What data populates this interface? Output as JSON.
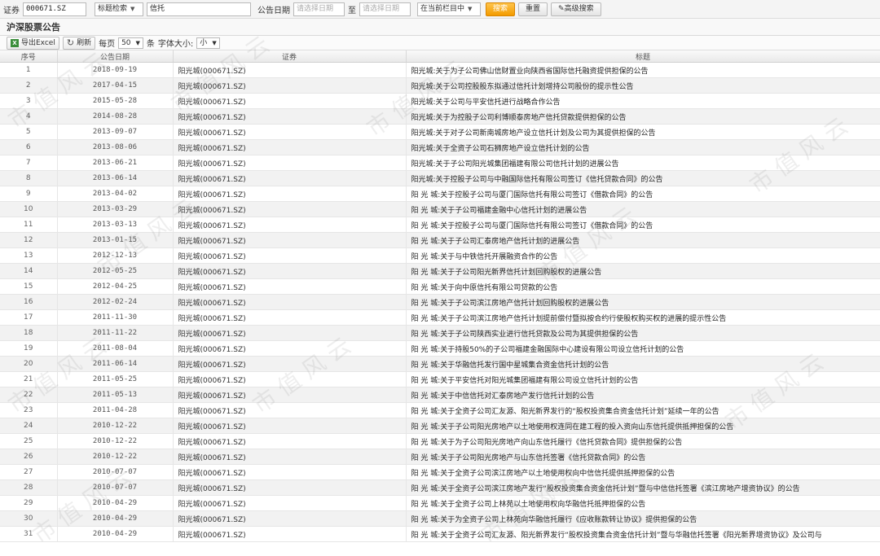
{
  "search": {
    "security_label": "证券",
    "security_value": "000671.SZ",
    "search_type": "标题检索",
    "keyword": "信托",
    "date_label": "公告日期",
    "date_from_placeholder": "请选择日期",
    "to_label": "至",
    "date_to_placeholder": "请选择日期",
    "scope": "在当前栏目中",
    "search_button": "搜索",
    "reset_button": "重置",
    "advanced_button": "高级搜索"
  },
  "section_title": "沪深股票公告",
  "toolbar": {
    "export_label": "导出Excel",
    "refresh_label": "刷新",
    "per_page_label": "每页",
    "per_page_value": "50",
    "per_page_unit": "条",
    "font_size_label": "字体大小:",
    "font_size_value": "小"
  },
  "table": {
    "headers": [
      "序号",
      "公告日期",
      "证券",
      "标题"
    ],
    "rows": [
      {
        "idx": "1",
        "date": "2018-09-19",
        "sec": "阳光城(000671.SZ)",
        "title": "阳光城:关于为子公司佛山信财置业向陕西省国际信托融资提供担保的公告"
      },
      {
        "idx": "2",
        "date": "2017-04-15",
        "sec": "阳光城(000671.SZ)",
        "title": "阳光城:关于公司控股股东拟通过信托计划增持公司股份的提示性公告"
      },
      {
        "idx": "3",
        "date": "2015-05-28",
        "sec": "阳光城(000671.SZ)",
        "title": "阳光城:关于公司与平安信托进行战略合作公告"
      },
      {
        "idx": "4",
        "date": "2014-08-28",
        "sec": "阳光城(000671.SZ)",
        "title": "阳光城:关于为控股子公司利博顺泰房地产信托贷款提供担保的公告"
      },
      {
        "idx": "5",
        "date": "2013-09-07",
        "sec": "阳光城(000671.SZ)",
        "title": "阳光城:关于对子公司新南城房地产设立信托计划及公司为其提供担保的公告"
      },
      {
        "idx": "6",
        "date": "2013-08-06",
        "sec": "阳光城(000671.SZ)",
        "title": "阳光城:关于全资子公司石狮房地产设立信托计划的公告"
      },
      {
        "idx": "7",
        "date": "2013-06-21",
        "sec": "阳光城(000671.SZ)",
        "title": "阳光城:关于子公司阳光城集团福建有限公司信托计划的进展公告"
      },
      {
        "idx": "8",
        "date": "2013-06-14",
        "sec": "阳光城(000671.SZ)",
        "title": "阳光城:关于控股子公司与中融国际信托有限公司签订《信托贷款合同》的公告"
      },
      {
        "idx": "9",
        "date": "2013-04-02",
        "sec": "阳光城(000671.SZ)",
        "title": "阳 光 城:关于控股子公司与厦门国际信托有限公司签订《借款合同》的公告"
      },
      {
        "idx": "10",
        "date": "2013-03-29",
        "sec": "阳光城(000671.SZ)",
        "title": "阳 光 城:关于子公司福建金融中心信托计划的进展公告"
      },
      {
        "idx": "11",
        "date": "2013-03-13",
        "sec": "阳光城(000671.SZ)",
        "title": "阳 光 城:关于控股子公司与厦门国际信托有限公司签订《借款合同》的公告"
      },
      {
        "idx": "12",
        "date": "2013-01-15",
        "sec": "阳光城(000671.SZ)",
        "title": "阳 光 城:关于子公司汇泰房地产信托计划的进展公告"
      },
      {
        "idx": "13",
        "date": "2012-12-13",
        "sec": "阳光城(000671.SZ)",
        "title": "阳 光 城:关于与中铁信托开展融资合作的公告"
      },
      {
        "idx": "14",
        "date": "2012-05-25",
        "sec": "阳光城(000671.SZ)",
        "title": "阳 光 城:关于子公司阳光新界信托计划回购股权的进展公告"
      },
      {
        "idx": "15",
        "date": "2012-04-25",
        "sec": "阳光城(000671.SZ)",
        "title": "阳 光 城:关于向中原信托有限公司贷款的公告"
      },
      {
        "idx": "16",
        "date": "2012-02-24",
        "sec": "阳光城(000671.SZ)",
        "title": "阳 光 城:关于子公司滨江房地产信托计划回购股权的进展公告"
      },
      {
        "idx": "17",
        "date": "2011-11-30",
        "sec": "阳光城(000671.SZ)",
        "title": "阳 光 城:关于子公司滨江房地产信托计划提前偿付暨拟按合约行使股权购买权的进展的提示性公告"
      },
      {
        "idx": "18",
        "date": "2011-11-22",
        "sec": "阳光城(000671.SZ)",
        "title": "阳 光 城:关于子公司陕西实业进行信托贷款及公司为其提供担保的公告"
      },
      {
        "idx": "19",
        "date": "2011-08-04",
        "sec": "阳光城(000671.SZ)",
        "title": "阳 光 城:关于持股50%的子公司福建金融国际中心建设有限公司设立信托计划的公告"
      },
      {
        "idx": "20",
        "date": "2011-06-14",
        "sec": "阳光城(000671.SZ)",
        "title": "阳 光 城:关于华融信托发行国中星城集合资金信托计划的公告"
      },
      {
        "idx": "21",
        "date": "2011-05-25",
        "sec": "阳光城(000671.SZ)",
        "title": "阳 光 城:关于平安信托对阳光城集团福建有限公司设立信托计划的公告"
      },
      {
        "idx": "22",
        "date": "2011-05-13",
        "sec": "阳光城(000671.SZ)",
        "title": "阳 光 城:关于中信信托对汇泰房地产发行信托计划的公告"
      },
      {
        "idx": "23",
        "date": "2011-04-28",
        "sec": "阳光城(000671.SZ)",
        "title": "阳 光 城:关于全资子公司汇友源、阳光新界发行的“股权投资集合资金信托计划”延续一年的公告"
      },
      {
        "idx": "24",
        "date": "2010-12-22",
        "sec": "阳光城(000671.SZ)",
        "title": "阳 光 城:关于子公司阳光房地产以土地使用权连同在建工程的投入资向山东信托提供抵押担保的公告"
      },
      {
        "idx": "25",
        "date": "2010-12-22",
        "sec": "阳光城(000671.SZ)",
        "title": "阳 光 城:关于为子公司阳光房地产向山东信托履行《信托贷款合同》提供担保的公告"
      },
      {
        "idx": "26",
        "date": "2010-12-22",
        "sec": "阳光城(000671.SZ)",
        "title": "阳 光 城:关于子公司阳光房地产与山东信托签署《信托贷款合同》的公告"
      },
      {
        "idx": "27",
        "date": "2010-07-07",
        "sec": "阳光城(000671.SZ)",
        "title": "阳 光 城:关于全资子公司滨江房地产以土地使用权向中信信托提供抵押担保的公告"
      },
      {
        "idx": "28",
        "date": "2010-07-07",
        "sec": "阳光城(000671.SZ)",
        "title": "阳 光 城:关于全资子公司滨江房地产发行“股权投资集合资金信托计划”暨与中信信托签署《滨江房地产增资协议》的公告"
      },
      {
        "idx": "29",
        "date": "2010-04-29",
        "sec": "阳光城(000671.SZ)",
        "title": "阳 光 城:关于全资子公司上林苑以土地使用权向华融信托抵押担保的公告"
      },
      {
        "idx": "30",
        "date": "2010-04-29",
        "sec": "阳光城(000671.SZ)",
        "title": "阳 光 城:关于为全资子公司上林苑向华融信托履行《应收账款转让协议》提供担保的公告"
      },
      {
        "idx": "31",
        "date": "2010-04-29",
        "sec": "阳光城(000671.SZ)",
        "title": "阳 光 城:关于全资子公司汇友源、阳光新界发行“股权投资集合资金信托计划”暨与华融信托签署《阳光新界增资协议》及公司与"
      }
    ]
  },
  "watermark": "市 值 风 云",
  "colors": {
    "accent": "#f39b00",
    "row_alt": "#f2f2f2"
  }
}
